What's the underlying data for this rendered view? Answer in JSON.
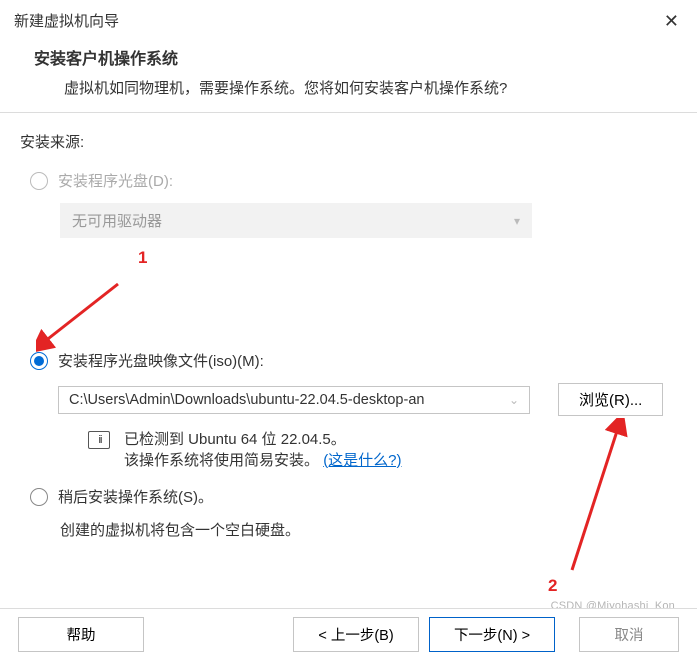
{
  "titlebar": {
    "title": "新建虚拟机向导"
  },
  "header": {
    "title": "安装客户机操作系统",
    "sub": "虚拟机如同物理机，需要操作系统。您将如何安装客户机操作系统?"
  },
  "source_label": "安装来源:",
  "option_disc": {
    "label": "安装程序光盘(D):",
    "select_text": "无可用驱动器"
  },
  "option_iso": {
    "label": "安装程序光盘映像文件(iso)(M):",
    "path": "C:\\Users\\Admin\\Downloads\\ubuntu-22.04.5-desktop-an",
    "browse": "浏览(R)...",
    "detected_line1": "已检测到 Ubuntu 64 位 22.04.5。",
    "detected_line2_pre": "该操作系统将使用简易安装。",
    "detected_link": "(这是什么?)"
  },
  "option_later": {
    "label": "稍后安装操作系统(S)。",
    "sub": "创建的虚拟机将包含一个空白硬盘。"
  },
  "annotations": {
    "one": "1",
    "two": "2"
  },
  "colors": {
    "annotation": "#e32424",
    "accent": "#006bd6"
  },
  "buttons": {
    "help": "帮助",
    "prev": "< 上一步(B)",
    "next": "下一步(N) >",
    "cancel": "取消"
  },
  "watermark": "CSDN @Miyohashi_Kon"
}
